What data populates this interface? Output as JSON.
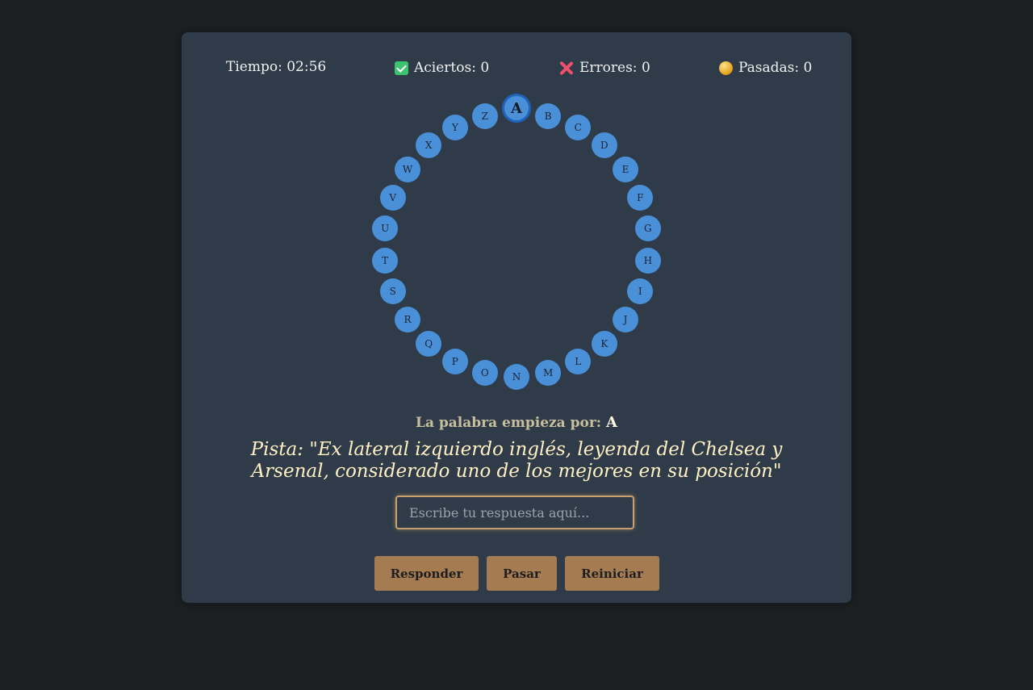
{
  "stats": {
    "time": "Tiempo: 02:56",
    "hits": "Aciertos: 0",
    "errors": "Errores: 0",
    "passed": "Pasadas: 0",
    "icons": {
      "hits": "check-icon",
      "errors": "cross-icon",
      "passed": "coin-icon"
    }
  },
  "rosco": {
    "letters": [
      "A",
      "B",
      "C",
      "D",
      "E",
      "F",
      "G",
      "H",
      "I",
      "J",
      "K",
      "L",
      "M",
      "N",
      "O",
      "P",
      "Q",
      "R",
      "S",
      "T",
      "U",
      "V",
      "W",
      "X",
      "Y",
      "Z"
    ],
    "current": "A",
    "color": "#4a90d9",
    "active_border_color": "#1d63b8"
  },
  "question": {
    "starts_label": "La palabra empieza por:",
    "starts_letter": "A",
    "hint": "Pista: \"Ex lateral izquierdo inglés, leyenda del Chelsea y Arsenal, considerado uno de los mejores en su posición\""
  },
  "input": {
    "placeholder": "Escribe tu respuesta aquí...",
    "value": ""
  },
  "buttons": {
    "answer": "Responder",
    "pass": "Pasar",
    "reset": "Reiniciar"
  },
  "colors": {
    "background": "#1d1f23",
    "panel": "#2f3b48",
    "button": "#a57b52",
    "hint_text": "#fff1c4"
  }
}
